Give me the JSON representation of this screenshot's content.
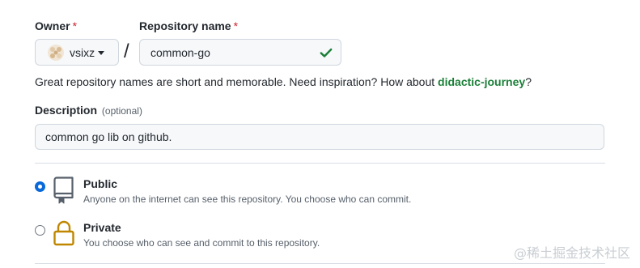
{
  "owner": {
    "label": "Owner",
    "required_mark": "*",
    "selected": "vsixz"
  },
  "repository": {
    "label": "Repository name",
    "required_mark": "*",
    "value": "common-go",
    "status_icon": "check-icon"
  },
  "separator": "/",
  "name_hint": {
    "text": "Great repository names are short and memorable. Need inspiration? How about ",
    "suggestion": "didactic-journey",
    "suffix": "?"
  },
  "description": {
    "label": "Description",
    "optional": "(optional)",
    "value": "common go lib on github."
  },
  "visibility": {
    "options": [
      {
        "title": "Public",
        "description": "Anyone on the internet can see this repository. You choose who can commit.",
        "icon": "repo-icon",
        "selected": true
      },
      {
        "title": "Private",
        "description": "You choose who can see and commit to this repository.",
        "icon": "lock-icon",
        "selected": false
      }
    ]
  },
  "watermark": "@稀土掘金技术社区",
  "colors": {
    "accent": "#0969da",
    "success": "#1a7f37",
    "required": "#cf222e",
    "lock": "#bf8700"
  }
}
